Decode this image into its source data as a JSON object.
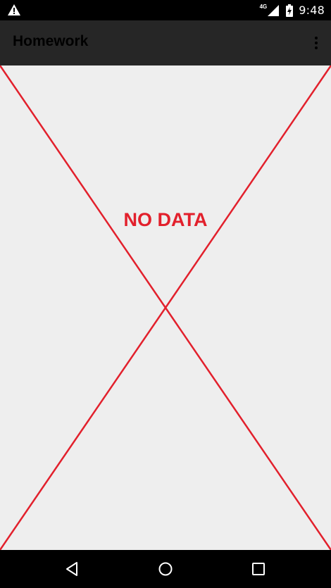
{
  "status_bar": {
    "network_type": "4G",
    "time": "9:48",
    "icons": [
      "warning-icon",
      "signal-icon",
      "battery-charging-icon"
    ]
  },
  "app_bar": {
    "title": "Homework",
    "menu_icon": "overflow-menu-icon"
  },
  "content": {
    "empty_message": "NO DATA",
    "accent_color": "#e2202c"
  },
  "nav_bar": {
    "icons": [
      "back-icon",
      "home-icon",
      "recents-icon"
    ]
  }
}
